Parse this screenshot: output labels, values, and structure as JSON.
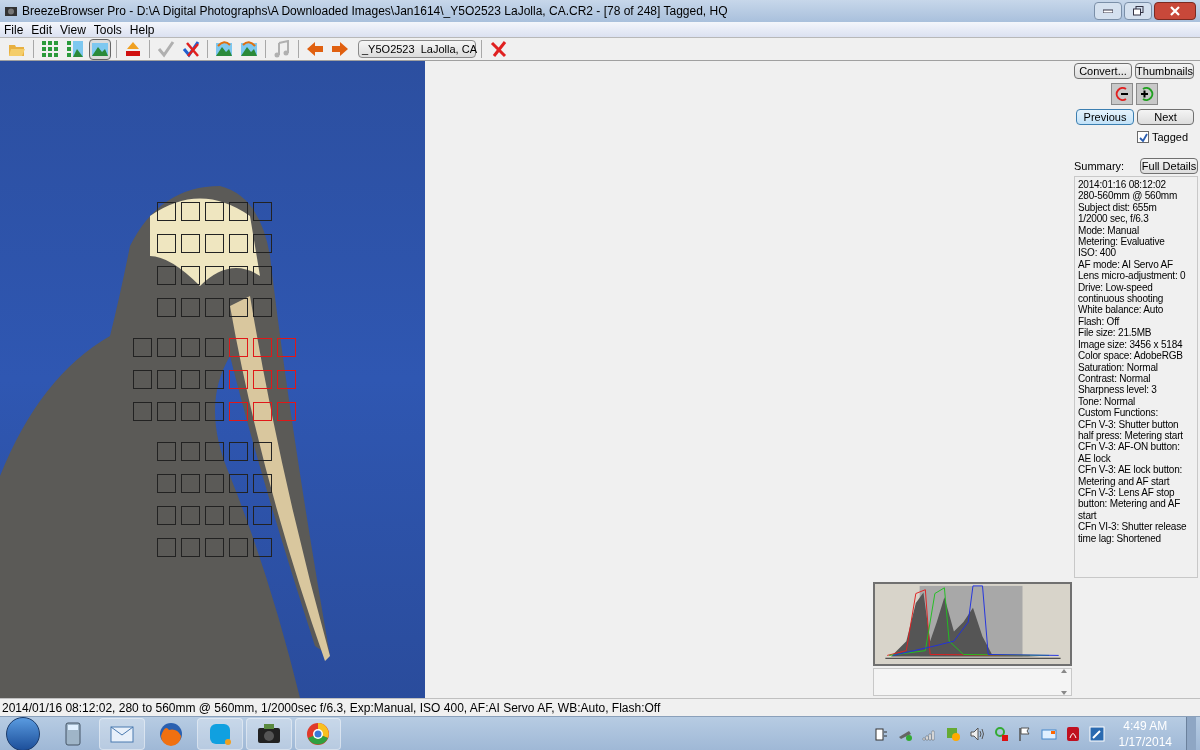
{
  "window": {
    "title": "BreezeBrowser Pro - D:\\A Digital Photographs\\A Downloaded Images\\Jan1614\\_Y5O2523  LaJolla, CA.CR2 - [78 of 248] Tagged, HQ"
  },
  "menu": [
    "File",
    "Edit",
    "View",
    "Tools",
    "Help"
  ],
  "toolbar": {
    "image_selector": "_Y5O2523  LaJolla, CA"
  },
  "af_points": [
    {
      "active": [
        false,
        false,
        false,
        false,
        false
      ]
    },
    {
      "active": [
        false,
        false,
        false,
        false,
        false
      ]
    },
    {
      "active": [
        false,
        false,
        false,
        false,
        false
      ]
    },
    {
      "active": [
        false,
        false,
        false,
        false,
        false
      ]
    },
    {
      "active": [
        false,
        false,
        false,
        false,
        true,
        true,
        true
      ]
    },
    {
      "active": [
        false,
        false,
        false,
        false,
        true,
        true,
        true
      ]
    },
    {
      "active": [
        false,
        false,
        false,
        false,
        true,
        true,
        true
      ]
    },
    {
      "active": [
        false,
        false,
        false,
        false,
        false
      ]
    },
    {
      "active": [
        false,
        false,
        false,
        false,
        false
      ]
    },
    {
      "active": [
        false,
        false,
        false,
        false,
        false
      ]
    },
    {
      "active": [
        false,
        false,
        false,
        false,
        false
      ]
    }
  ],
  "panel": {
    "convert": "Convert...",
    "thumbnails": "Thumbnails",
    "previous": "Previous",
    "next": "Next",
    "tagged": {
      "label": "Tagged",
      "checked": true
    },
    "summary_label": "Summary:",
    "full_details": "Full Details",
    "summary_lines": [
      "2014:01:16 08:12:02",
      "280-560mm @ 560mm",
      "Subject dist: 655m",
      "1/2000 sec, f/6.3",
      "Mode: Manual",
      "Metering: Evaluative",
      "ISO: 400",
      "AF mode: AI Servo AF",
      "Lens micro-adjustment: 0",
      "Drive: Low-speed continuous shooting",
      "White balance: Auto",
      "Flash: Off",
      "File size: 21.5MB",
      "Image size: 3456 x 5184",
      "Color space: AdobeRGB",
      "Saturation: Normal",
      "Contrast: Normal",
      "Sharpness level: 3",
      "Tone: Normal",
      "Custom Functions:",
      "CFn V-3: Shutter button half press: Metering start",
      "CFn V-3: AF-ON button: AE lock",
      "CFn V-3: AE lock button: Metering and AF start",
      "CFn V-3: Lens AF stop button: Metering and AF start",
      "CFn VI-3: Shutter release time lag: Shortened"
    ]
  },
  "status_bar": "2014/01/16 08:12:02, 280 to 560mm @ 560mm, 1/2000sec f/6.3, Exp:Manual, ISO 400, AF:AI Servo AF, WB:Auto, Flash:Off",
  "taskbar": {
    "clock_time": "4:49 AM",
    "clock_date": "1/17/2014"
  }
}
